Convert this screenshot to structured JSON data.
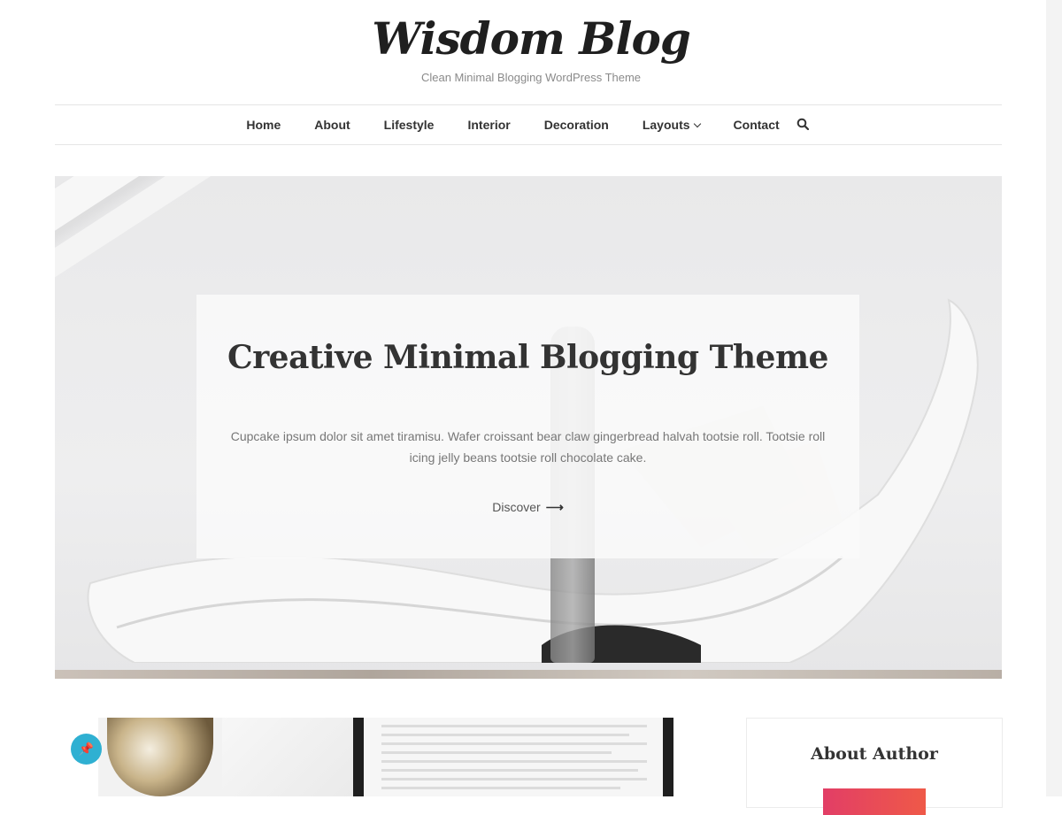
{
  "site": {
    "title": "Wisdom Blog",
    "tagline": "Clean Minimal Blogging WordPress Theme"
  },
  "nav": {
    "items": [
      {
        "label": "Home"
      },
      {
        "label": "About"
      },
      {
        "label": "Lifestyle"
      },
      {
        "label": "Interior"
      },
      {
        "label": "Decoration"
      },
      {
        "label": "Layouts",
        "has_dropdown": true
      },
      {
        "label": "Contact"
      }
    ],
    "search_icon": "search-icon"
  },
  "hero": {
    "title": "Creative Minimal Blogging Theme",
    "description": "Cupcake ipsum dolor sit amet tiramisu. Wafer croissant bear claw gingerbread halvah tootsie roll. Tootsie roll icing jelly beans tootsie roll chocolate cake.",
    "cta_label": "Discover",
    "cta_icon": "arrow-right-icon"
  },
  "post": {
    "sticky_icon": "pin-icon",
    "sticky_color": "#2fb0d2"
  },
  "sidebar": {
    "widget_title": "About Author",
    "author_image_gradient": [
      "#e23e66",
      "#ef5948"
    ]
  }
}
